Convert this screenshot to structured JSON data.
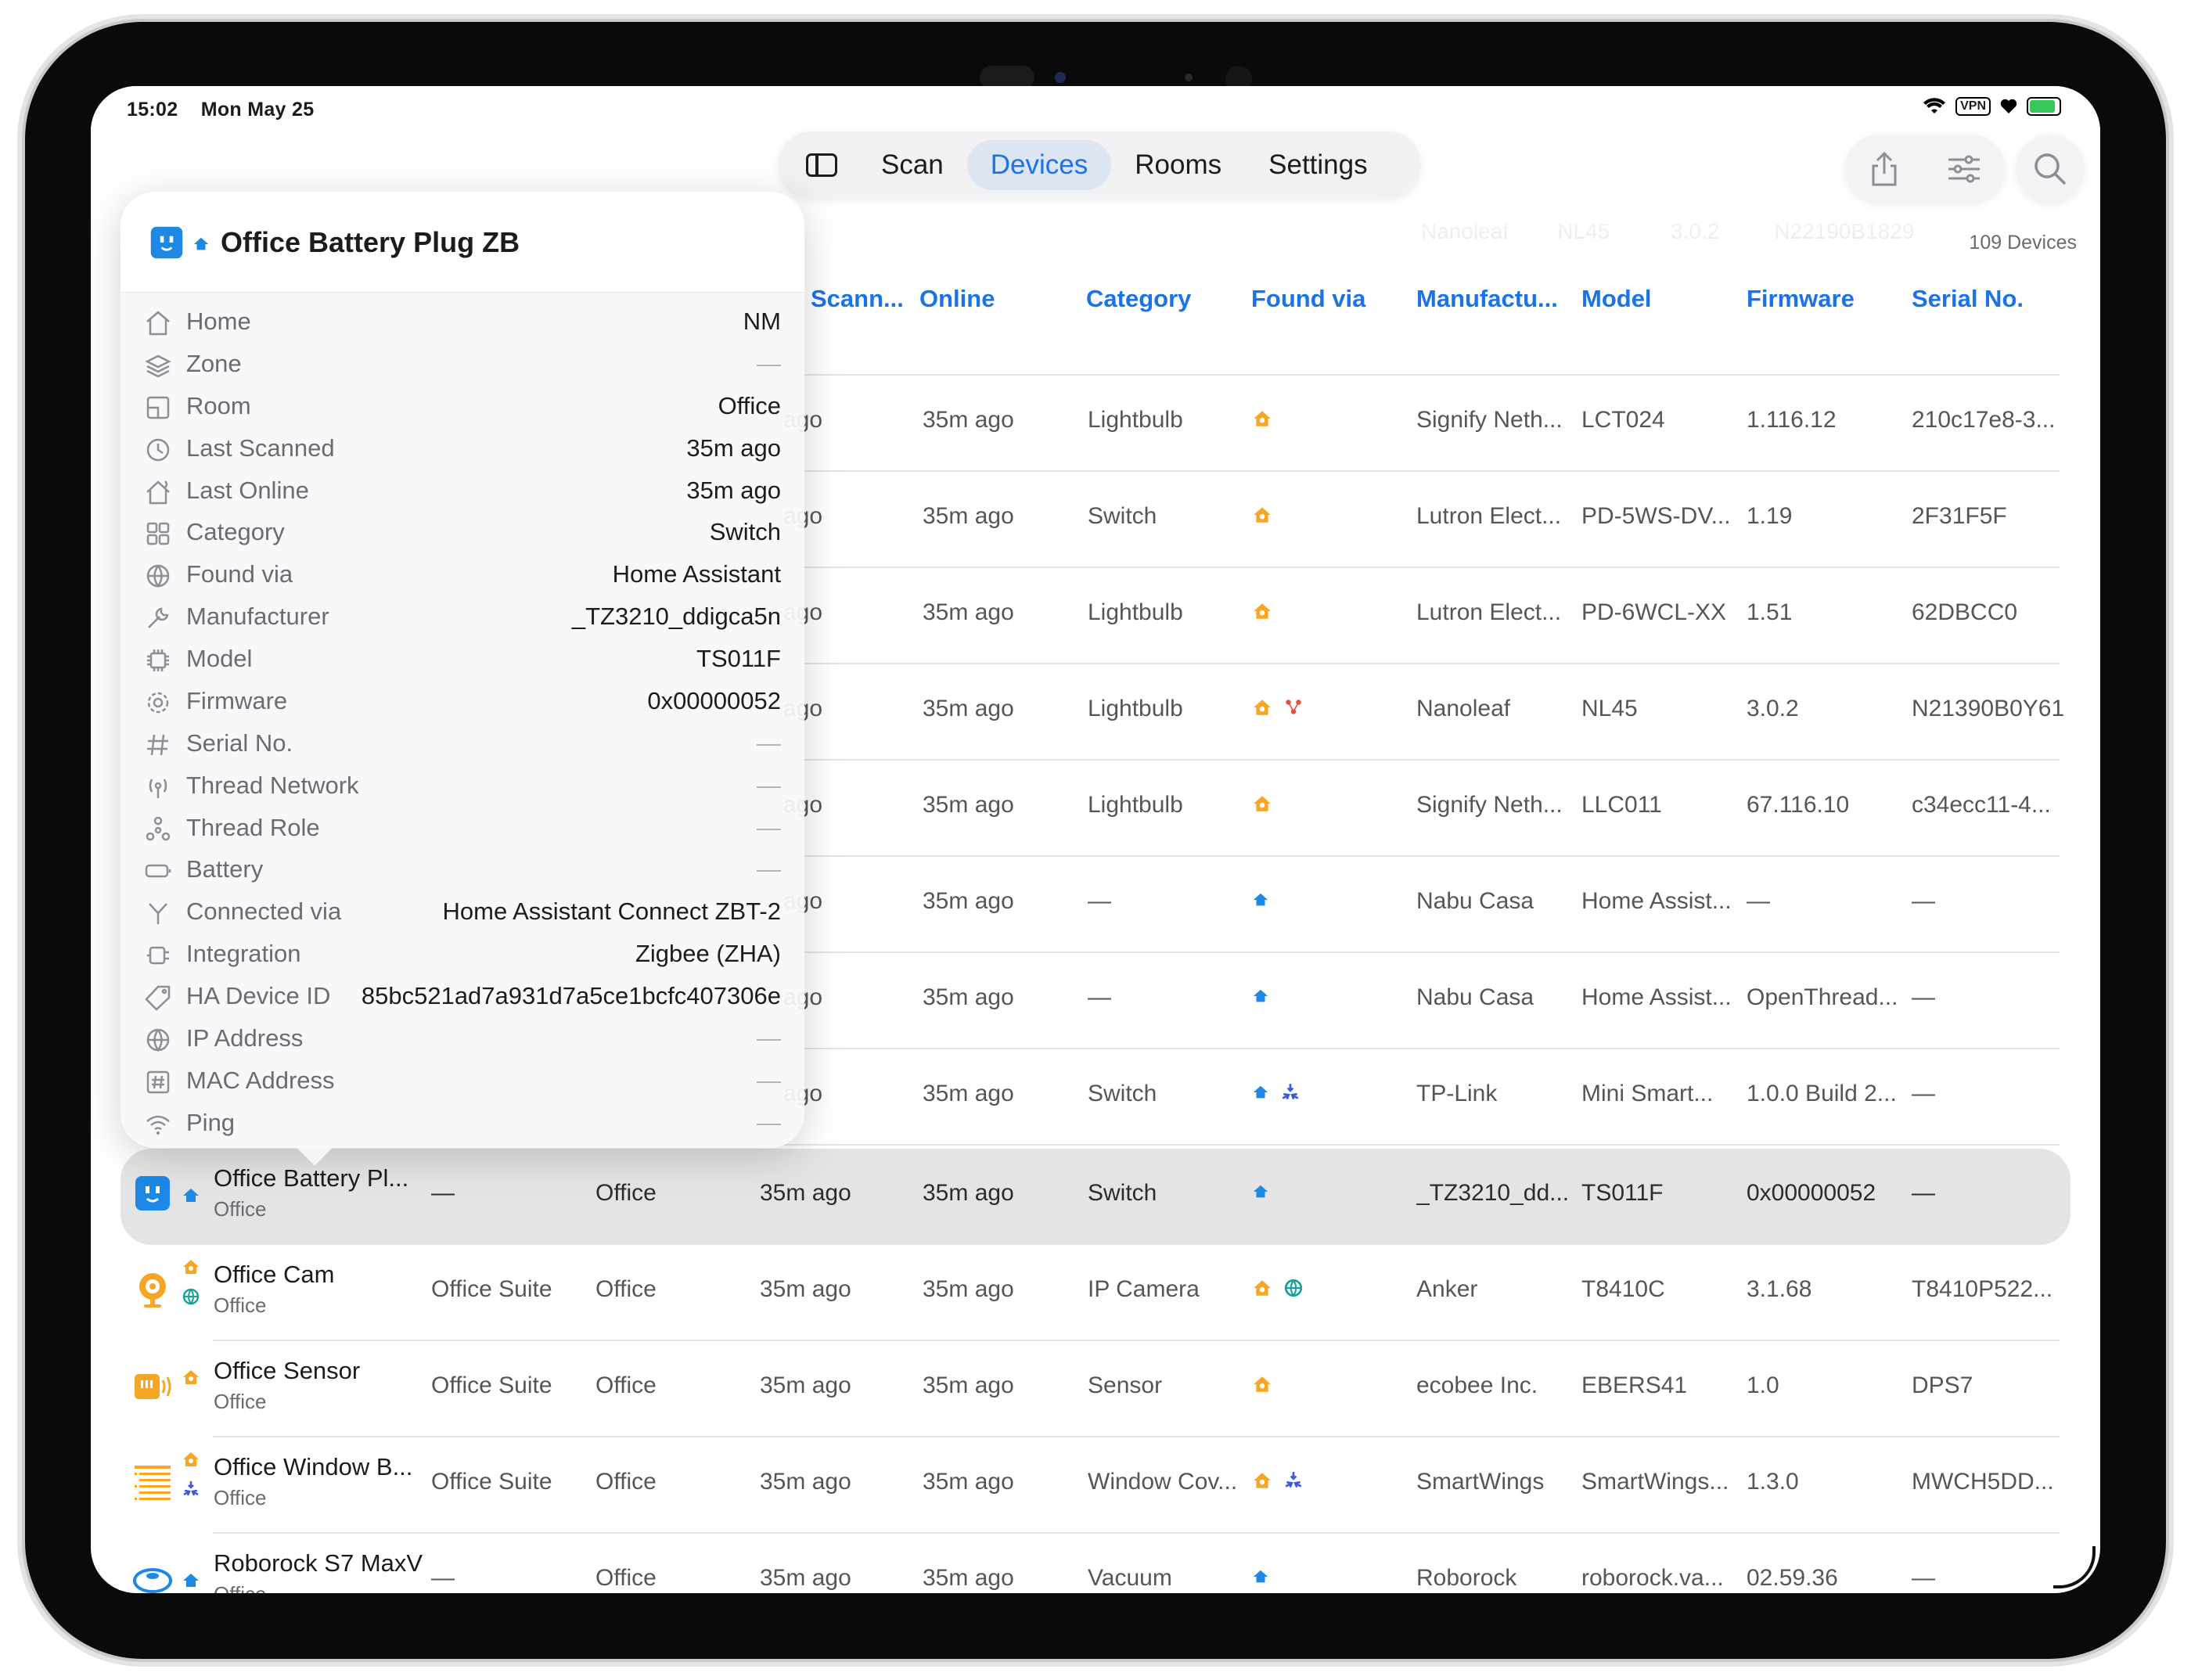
{
  "status_bar": {
    "time": "15:02",
    "date": "Mon May 25",
    "vpn": "VPN"
  },
  "nav": {
    "tabs": [
      "Scan",
      "Devices",
      "Rooms",
      "Settings"
    ],
    "active_tab": "Devices"
  },
  "device_count": "109 Devices",
  "columns": [
    "Scann...",
    "Online",
    "Category",
    "Found via",
    "Manufactu...",
    "Model",
    "Firmware",
    "Serial No."
  ],
  "rows": [
    {
      "scanned": "ago",
      "online": "35m ago",
      "category": "Lightbulb",
      "found": [
        "home-assistant"
      ],
      "manufacturer": "Signify Neth...",
      "model": "LCT024",
      "firmware": "1.116.12",
      "serial": "210c17e8-3..."
    },
    {
      "scanned": "ago",
      "online": "35m ago",
      "category": "Switch",
      "found": [
        "home-assistant"
      ],
      "manufacturer": "Lutron Elect...",
      "model": "PD-5WS-DV...",
      "firmware": "1.19",
      "serial": "2F31F5F"
    },
    {
      "scanned": "ago",
      "online": "35m ago",
      "category": "Lightbulb",
      "found": [
        "home-assistant"
      ],
      "manufacturer": "Lutron Elect...",
      "model": "PD-6WCL-XX",
      "firmware": "1.51",
      "serial": "62DBCC0"
    },
    {
      "scanned": "ago",
      "online": "35m ago",
      "category": "Lightbulb",
      "found": [
        "home-assistant",
        "nanoleaf"
      ],
      "manufacturer": "Nanoleaf",
      "model": "NL45",
      "firmware": "3.0.2",
      "serial": "N21390B0Y61"
    },
    {
      "scanned": "ago",
      "online": "35m ago",
      "category": "Lightbulb",
      "found": [
        "home-assistant"
      ],
      "manufacturer": "Signify Neth...",
      "model": "LLC011",
      "firmware": "67.116.10",
      "serial": "c34ecc11-4..."
    },
    {
      "scanned": "ago",
      "online": "35m ago",
      "category": "—",
      "found": [
        "zigbee"
      ],
      "manufacturer": "Nabu Casa",
      "model": "Home Assist...",
      "firmware": "—",
      "serial": "—"
    },
    {
      "scanned": "ago",
      "online": "35m ago",
      "category": "—",
      "found": [
        "zigbee"
      ],
      "manufacturer": "Nabu Casa",
      "model": "Home Assist...",
      "firmware": "OpenThread...",
      "serial": "—"
    },
    {
      "scanned": "ago",
      "online": "35m ago",
      "category": "Switch",
      "found": [
        "zigbee",
        "matter"
      ],
      "manufacturer": "TP-Link",
      "model": "Mini Smart...",
      "firmware": "1.0.0 Build 2...",
      "serial": "—"
    }
  ],
  "selected_row": {
    "name": "Office Battery Pl...",
    "room_label": "Office",
    "zone": "—",
    "room": "Office",
    "scanned": "35m ago",
    "online": "35m ago",
    "category": "Switch",
    "manufacturer": "_TZ3210_dd...",
    "model": "TS011F",
    "firmware": "0x00000052",
    "serial": "—"
  },
  "lower_rows": [
    {
      "name": "Office Cam",
      "room_label": "Office",
      "zone": "Office Suite",
      "room": "Office",
      "scanned": "35m ago",
      "online": "35m ago",
      "category": "IP Camera",
      "manufacturer": "Anker",
      "model": "T8410C",
      "firmware": "3.1.68",
      "serial": "T8410P522..."
    },
    {
      "name": "Office Sensor",
      "room_label": "Office",
      "zone": "Office Suite",
      "room": "Office",
      "scanned": "35m ago",
      "online": "35m ago",
      "category": "Sensor",
      "manufacturer": "ecobee Inc.",
      "model": "EBERS41",
      "firmware": "1.0",
      "serial": "DPS7"
    },
    {
      "name": "Office Window B...",
      "room_label": "Office",
      "zone": "Office Suite",
      "room": "Office",
      "scanned": "35m ago",
      "online": "35m ago",
      "category": "Window Cov...",
      "manufacturer": "SmartWings",
      "model": "SmartWings...",
      "firmware": "1.3.0",
      "serial": "MWCH5DD..."
    },
    {
      "name": "Roborock S7 MaxV",
      "room_label": "Office",
      "zone": "—",
      "room": "Office",
      "scanned": "35m ago",
      "online": "35m ago",
      "category": "Vacuum",
      "manufacturer": "Roborock",
      "model": "roborock.va...",
      "firmware": "02.59.36",
      "serial": "—"
    }
  ],
  "popover": {
    "title": "Office Battery Plug ZB",
    "fields": [
      {
        "icon": "house-icon",
        "label": "Home",
        "value": "NM"
      },
      {
        "icon": "layers-icon",
        "label": "Zone",
        "value": "—"
      },
      {
        "icon": "room-icon",
        "label": "Room",
        "value": "Office"
      },
      {
        "icon": "clock-icon",
        "label": "Last Scanned",
        "value": "35m ago"
      },
      {
        "icon": "house-signal-icon",
        "label": "Last Online",
        "value": "35m ago"
      },
      {
        "icon": "grid-icon",
        "label": "Category",
        "value": "Switch"
      },
      {
        "icon": "globe-icon",
        "label": "Found via",
        "value": "Home Assistant"
      },
      {
        "icon": "wrench-icon",
        "label": "Manufacturer",
        "value": "_TZ3210_ddigca5n"
      },
      {
        "icon": "chip-icon",
        "label": "Model",
        "value": "TS011F"
      },
      {
        "icon": "gear-icon",
        "label": "Firmware",
        "value": "0x00000052"
      },
      {
        "icon": "hash-icon",
        "label": "Serial No.",
        "value": "—"
      },
      {
        "icon": "antenna-icon",
        "label": "Thread Network",
        "value": "—"
      },
      {
        "icon": "nodes-icon",
        "label": "Thread Role",
        "value": "—"
      },
      {
        "icon": "battery-icon",
        "label": "Battery",
        "value": "—"
      },
      {
        "icon": "fork-icon",
        "label": "Connected via",
        "value": "Home Assistant Connect ZBT-2"
      },
      {
        "icon": "plug-icon",
        "label": "Integration",
        "value": "Zigbee (ZHA)"
      },
      {
        "icon": "tag-icon",
        "label": "HA Device ID",
        "value": "85bc521ad7a931d7a5ce1bcfc407306e"
      },
      {
        "icon": "globe-icon",
        "label": "IP Address",
        "value": "—"
      },
      {
        "icon": "hash-box-icon",
        "label": "MAC Address",
        "value": "—"
      },
      {
        "icon": "wifi-icon",
        "label": "Ping",
        "value": "—"
      }
    ]
  },
  "colors": {
    "accent": "#1a73e8",
    "home_assistant": "#f5a623",
    "zigbee": "#1e88e5",
    "matter": "#3b5bdb",
    "nanoleaf": "#e8503a",
    "selection": "#e4e4e6"
  }
}
